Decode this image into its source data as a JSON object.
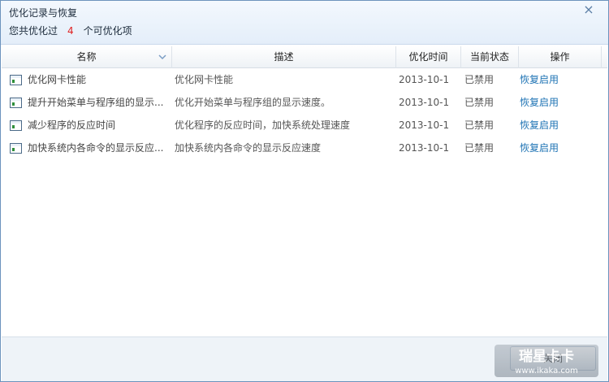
{
  "window": {
    "title": "优化记录与恢复",
    "summary_prefix": "您共优化过",
    "summary_count": "4",
    "summary_suffix": "个可优化项",
    "close_glyph": "×"
  },
  "table": {
    "headers": {
      "name": "名称",
      "description": "描述",
      "time": "优化时间",
      "status": "当前状态",
      "action": "操作"
    },
    "rows": [
      {
        "name": "优化网卡性能",
        "description": "优化网卡性能",
        "time": "2013-10-1",
        "status": "已禁用",
        "action": "恢复启用"
      },
      {
        "name": "提升开始菜单与程序组的显示...",
        "description": "优化开始菜单与程序组的显示速度。",
        "time": "2013-10-1",
        "status": "已禁用",
        "action": "恢复启用"
      },
      {
        "name": "减少程序的反应时间",
        "description": "优化程序的反应时间，加快系统处理速度",
        "time": "2013-10-1",
        "status": "已禁用",
        "action": "恢复启用"
      },
      {
        "name": "加快系统内各命令的显示反应...",
        "description": "加快系统内各命令的显示反应速度",
        "time": "2013-10-1",
        "status": "已禁用",
        "action": "恢复启用"
      }
    ]
  },
  "footer": {
    "close_label": "关闭"
  },
  "watermark": {
    "line1": "瑞星卡卡",
    "line2": "www.ikaka.com"
  },
  "colors": {
    "count": "#e02020",
    "link": "#1e73b4",
    "accent": "#6c93bd"
  }
}
